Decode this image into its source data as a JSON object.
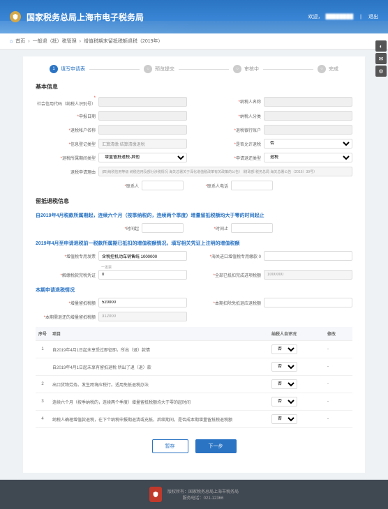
{
  "header": {
    "title": "国家税务总局上海市电子税务局",
    "welcome": "欢迎，",
    "logout": "退出"
  },
  "breadcrumb": {
    "home": "首页",
    "level1": "一般退（抵）税管理",
    "level2": "增值税期末留抵税额退税（2019年）"
  },
  "steps": [
    {
      "num": "1",
      "label": "填写申请表"
    },
    {
      "num": "2",
      "label": "预览提交"
    },
    {
      "num": "3",
      "label": "审核中"
    },
    {
      "num": "4",
      "label": "完成"
    }
  ],
  "sections": {
    "basic": "基本信息",
    "liudi": "留抵退税信息",
    "blue1": "自2019年4月税款所属期起，连续六个月（按季纳税的，连续两个季度）增量留抵税额均大于零的时间起止",
    "blue2": "2019年4月至申请退税前一税款所属期已抵扣的增值税额情况，填写相关凭证上注明的增值税额",
    "blue3": "本期申请退税情况"
  },
  "fields": {
    "nsrsbh_label": "社会信用代码（纳税人识别号）",
    "nsrmc_label": "纳税人名称",
    "nsrmc_val": "",
    "sbrq_label": "申报日期",
    "sssq_label": "纳税人分类",
    "lxrmc_label": "退税帐户名称",
    "lxdh_label": "退税银行账户",
    "xstse_label": "信息登记类型",
    "xstse_val": "汇算清缴 结算清缴退税",
    "btslx_label": "是否允许退税",
    "btslx_val": "否",
    "sysb_label": "退税所属期间类型",
    "sysb_val": "增量留抵退税-其他",
    "sfzh_label": "申请退还类型",
    "sfzh_val": "退税",
    "addr_label": "退税申请理由",
    "addr_val": "(四)纳税信用等级 纳税信用及部分涉税情况 海关总署关于深化增值税改革有关政策的公告）（财政部 税务总局 海关总署公告（2016）39号）",
    "jbr_label": "联系人",
    "jbrdh_label": "联系人电话",
    "qsrq_label": "时间起",
    "zzrq_label": "时间止",
    "zyfp_label": "增值税专用发票",
    "zyfp_val": "含税控机动车销售统 1000000",
    "zyfp_sub": "一发票",
    "hgjk_label": "海关进口增值税专用缴款 0",
    "jspz_label": "解缴税款完税凭证",
    "jspz_val": "0",
    "yjse_label": "全部已抵扣完成进项税额",
    "yjse_val": "1000000",
    "zlld_label": "增量留抵税额",
    "zlld_val": "520000",
    "bqsb_label": "本期扣除免抵退应退税额",
    "bqsb_val": "",
    "jsbl_label": "本期需退还的增量留抵税额",
    "jsbl_val": "312000"
  },
  "table": {
    "headers": [
      "序号",
      "项目",
      "纳税人自评况",
      "修改"
    ],
    "rows": [
      {
        "idx": "1",
        "item": "自2019年4月1日起未享受过即征即。所出（退）款情",
        "val": "否",
        "op": "-"
      },
      {
        "idx": "",
        "item": "自2019年4月1日起未享有留抵退税 所出了退（退）款",
        "val": "否",
        "op": "-"
      },
      {
        "idx": "2",
        "item": "出口货物劳务。发生跨境应税行。适用免抵退税办法",
        "val": "否",
        "op": "-"
      },
      {
        "idx": "3",
        "item": "连续六个月（按季纳税的，连续两个季度）增量留抵税额均大于零的起时间",
        "val": "否",
        "op": "-"
      },
      {
        "idx": "4",
        "item": "纳税人确理增值款退税，在下个纳税申报期退清或充抵，后续期间，是否成本期增量留抵税退税额",
        "val": "否",
        "op": "-"
      }
    ]
  },
  "buttons": {
    "save": "暂存",
    "next": "下一步"
  },
  "footer": {
    "copyright": "版权所有：国家税务总局上海市税务局",
    "phone": "服务电话：021-12366"
  }
}
